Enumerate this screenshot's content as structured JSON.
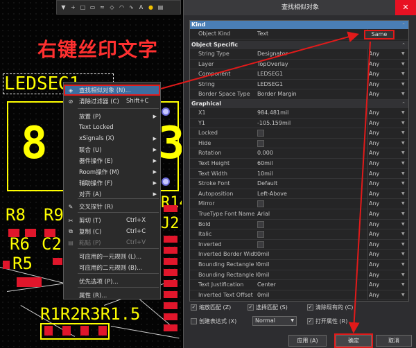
{
  "headline": "右键丝印文字",
  "toolbar": {
    "icons": [
      "filter-icon",
      "text-icon",
      "route-icon",
      "rect-icon",
      "pad-icon",
      "line-icon",
      "via-icon",
      "arc-icon",
      "sig-icon",
      "text2-icon",
      "dot-icon",
      "settings-icon"
    ]
  },
  "pcb": {
    "designator": "LEDSEG1",
    "seg_left": "8",
    "seg_right": "3",
    "refs": {
      "r8": "R8",
      "r9": "R9",
      "r6": "R6",
      "c2": "C2",
      "r5": "R5",
      "r14": "R14",
      "j2": "J2",
      "r1_2": "R1",
      "bottom": "R1R2R3R1.5"
    }
  },
  "context_menu": {
    "items": [
      {
        "label": "查找相似对象 (N)...",
        "shortcut": "",
        "icon": "find-similar-icon"
      },
      {
        "label": "清除过滤器 (C)",
        "shortcut": "Shift+C",
        "icon": "clear-filter-icon"
      },
      {
        "label": "放置 (P)",
        "shortcut": "",
        "icon": ""
      },
      {
        "label": "Text Locked",
        "shortcut": "",
        "icon": ""
      },
      {
        "label": "xSignals (X)",
        "shortcut": "",
        "icon": ""
      },
      {
        "label": "联合 (U)",
        "shortcut": "",
        "icon": ""
      },
      {
        "label": "器件操作 (E)",
        "shortcut": "",
        "icon": ""
      },
      {
        "label": "Room操作 (M)",
        "shortcut": "",
        "icon": ""
      },
      {
        "label": "辅助操作 (F)",
        "shortcut": "",
        "icon": ""
      },
      {
        "label": "对齐 (A)",
        "shortcut": "",
        "icon": ""
      },
      {
        "label": "交叉探针 (R)",
        "shortcut": "",
        "icon": "cross-probe-icon"
      },
      {
        "label": "剪切 (T)",
        "shortcut": "Ctrl+X",
        "icon": "cut-icon"
      },
      {
        "label": "复制 (C)",
        "shortcut": "Ctrl+C",
        "icon": "copy-icon"
      },
      {
        "label": "粘贴 (P)",
        "shortcut": "Ctrl+V",
        "icon": "paste-icon"
      },
      {
        "label": "可应用的一元规则 (L)...",
        "shortcut": "",
        "icon": ""
      },
      {
        "label": "可应用的二元规则 (B)...",
        "shortcut": "",
        "icon": ""
      },
      {
        "label": "优先选项 (P)...",
        "shortcut": "",
        "icon": ""
      },
      {
        "label": "属性 (R)...",
        "shortcut": "",
        "icon": ""
      }
    ]
  },
  "dialog": {
    "title": "查找相似对象",
    "close": "✕",
    "sections": {
      "kind": "Kind",
      "object_specific": "Object Specific",
      "graphical": "Graphical"
    },
    "kind_rows": [
      {
        "name": "Object Kind",
        "value": "Text",
        "match": "Same"
      }
    ],
    "object_rows": [
      {
        "name": "String Type",
        "value": "Designator",
        "match": "Any"
      },
      {
        "name": "Layer",
        "value": "TopOverlay",
        "match": "Any"
      },
      {
        "name": "Component",
        "value": "LEDSEG1",
        "match": "Any"
      },
      {
        "name": "String",
        "value": "LEDSEG1",
        "match": "Any"
      },
      {
        "name": "Border Space Type",
        "value": "Border Margin",
        "match": "Any"
      }
    ],
    "graphical_rows": [
      {
        "name": "X1",
        "value": "984.481mil",
        "match": "Any"
      },
      {
        "name": "Y1",
        "value": "-105.159mil",
        "match": "Any"
      },
      {
        "name": "Locked",
        "value": "",
        "match": "Any",
        "check": true
      },
      {
        "name": "Hide",
        "value": "",
        "match": "Any",
        "check": true
      },
      {
        "name": "Rotation",
        "value": "0.000",
        "match": "Any"
      },
      {
        "name": "Text Height",
        "value": "60mil",
        "match": "Any"
      },
      {
        "name": "Text Width",
        "value": "10mil",
        "match": "Any"
      },
      {
        "name": "Stroke Font",
        "value": "Default",
        "match": "Any"
      },
      {
        "name": "Autoposition",
        "value": "Left-Above",
        "match": "Any"
      },
      {
        "name": "Mirror",
        "value": "",
        "match": "Any",
        "check": true
      },
      {
        "name": "TrueType Font Name",
        "value": "Arial",
        "match": "Any"
      },
      {
        "name": "Bold",
        "value": "",
        "match": "Any",
        "check": true
      },
      {
        "name": "Italic",
        "value": "",
        "match": "Any",
        "check": true
      },
      {
        "name": "Inverted",
        "value": "",
        "match": "Any",
        "check": true
      },
      {
        "name": "Inverted Border Width",
        "value": "0mil",
        "match": "Any"
      },
      {
        "name": "Bounding Rectangle Wid",
        "value": "0mil",
        "match": "Any"
      },
      {
        "name": "Bounding Rectangle Hei",
        "value": "0mil",
        "match": "Any"
      },
      {
        "name": "Text Justification",
        "value": "Center",
        "match": "Any"
      },
      {
        "name": "Inverted Text Offset",
        "value": "0mil",
        "match": "Any"
      }
    ],
    "options": {
      "zoom_matching": "缩放匹配 (Z)",
      "select_matching": "选择匹配 (S)",
      "clear_existing": "清除现有的 (C)",
      "create_expression": "创建表达式 (X)",
      "mode_value": "Normal",
      "open_properties": "打开属性 (R)"
    },
    "buttons": {
      "apply": "应用 (A)",
      "ok": "确定",
      "cancel": "取消"
    }
  },
  "colors": {
    "silk": "#ffff00",
    "pad": "#e0162b",
    "highlight": "#e21a1a",
    "kind_header": "#4a7eb5"
  }
}
